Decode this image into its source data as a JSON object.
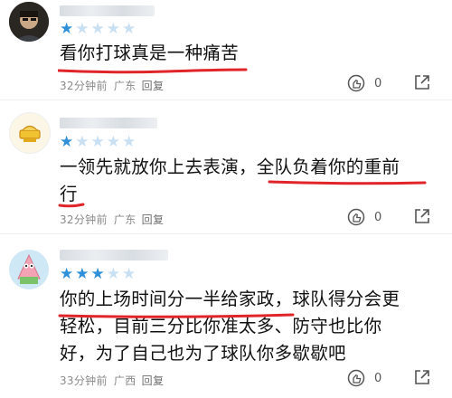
{
  "comments": [
    {
      "stars": [
        1,
        0,
        0,
        0,
        0
      ],
      "text": [
        "看你打球真是一种痛苦"
      ],
      "time": "32分钟前",
      "location": "广东",
      "reply_label": "回复",
      "like_count": "0"
    },
    {
      "stars": [
        1,
        0,
        0,
        0,
        0
      ],
      "text": [
        "一领先就放你上去表演，全队负着你的重前",
        "行"
      ],
      "time": "32分钟前",
      "location": "广东",
      "reply_label": "回复",
      "like_count": "0"
    },
    {
      "stars": [
        1,
        1,
        1,
        0,
        0
      ],
      "text": [
        "你的上场时间分一半给家政，球队得分会更",
        "轻松，目前三分比你准太多、防守也比你",
        "好，为了自己也为了球队你多歇歇吧"
      ],
      "time": "33分钟前",
      "location": "广西",
      "reply_label": "回复",
      "like_count": "0"
    }
  ],
  "colors": {
    "star_on": "#2f8fd8",
    "star_off": "#c9e0f3",
    "underline": "#e0252a"
  },
  "icons": {
    "like": "thumb-up-icon",
    "share": "share-icon",
    "star": "star-icon"
  }
}
